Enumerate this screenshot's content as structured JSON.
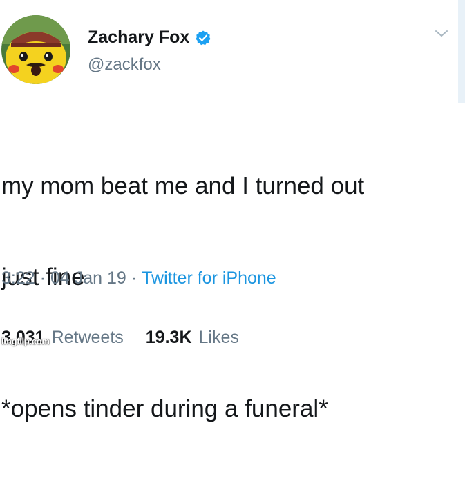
{
  "author": {
    "display_name": "Zachary Fox",
    "handle": "@zackfox",
    "verified": true,
    "avatar_icon": "surprised-pikachu-avatar"
  },
  "menu_icon": "chevron-down-icon",
  "tweet": {
    "line1": "my mom beat me and I turned out",
    "line2": "just fine",
    "line3": "*opens tinder during a funeral*"
  },
  "meta": {
    "time": "3:22",
    "separator": "·",
    "date": "04 Jan 19",
    "source": "Twitter for iPhone"
  },
  "stats": {
    "retweets_count": "3,031",
    "retweets_label": "Retweets",
    "likes_count": "19.3K",
    "likes_label": "Likes"
  },
  "watermark": "imgflip.com",
  "colors": {
    "link": "#1b95e0",
    "secondary_text": "#657786",
    "primary_text": "#14171a",
    "verified_badge": "#1da1f2"
  }
}
